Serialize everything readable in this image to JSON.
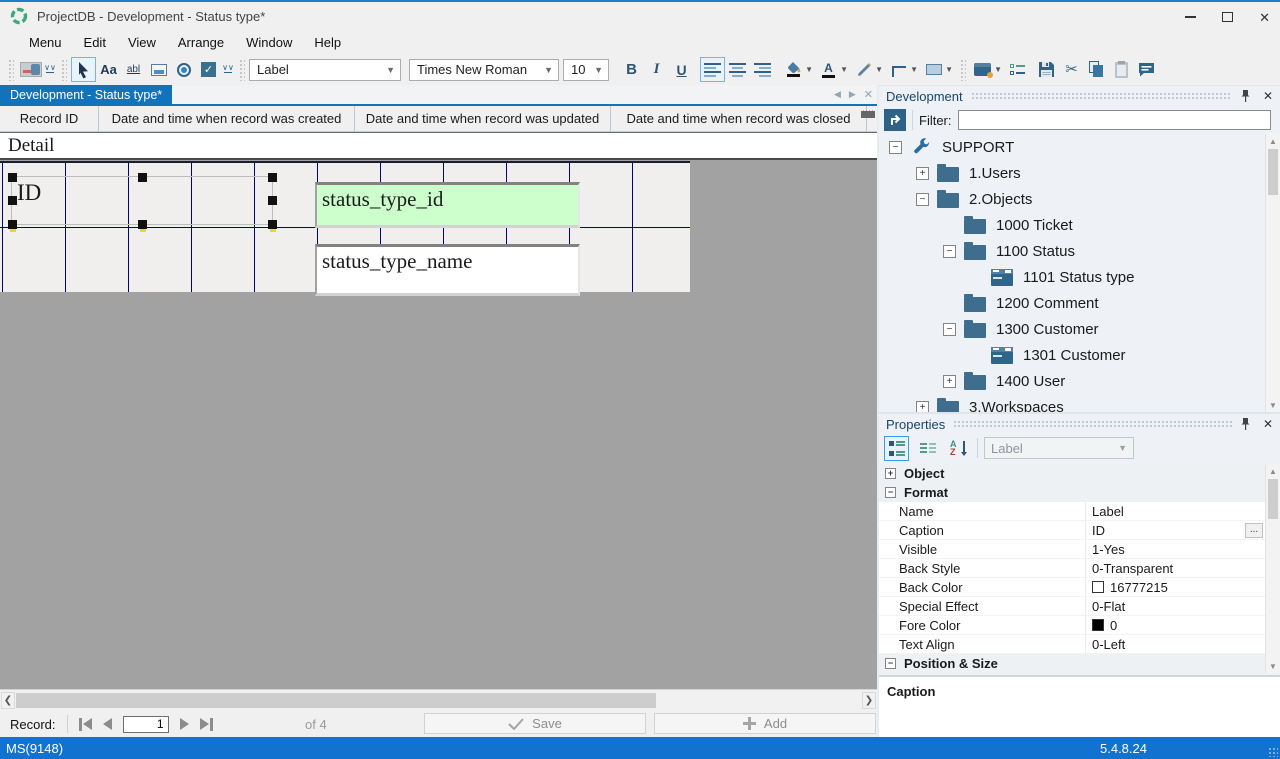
{
  "app": {
    "title": "ProjectDB - Development - Status type*",
    "status_left": "MS(9148)",
    "version": "5.4.8.24"
  },
  "menu": {
    "items": [
      "Menu",
      "Edit",
      "View",
      "Arrange",
      "Window",
      "Help"
    ]
  },
  "toolbar": {
    "control_selector": "Label",
    "font_name": "Times New Roman",
    "font_size": "10",
    "icons": {
      "bold": "B",
      "italic": "I",
      "underline": "U",
      "label_tool": "Aa",
      "textbox_tool": "abl",
      "checkbox_check": "✓",
      "cut": "✂"
    }
  },
  "tab_bar": {
    "active_tab": "Development - Status type*"
  },
  "grid_columns": {
    "headers": [
      "Record ID",
      "Date and time when record was created",
      "Date and time when record was updated",
      "Date and time when record was closed"
    ]
  },
  "designer": {
    "section_title": "Detail",
    "selected_label": "ID",
    "fields": [
      {
        "text": "status_type_id",
        "bg": "#ccffcc"
      },
      {
        "text": "status_type_name",
        "bg": "#ffffff"
      }
    ]
  },
  "development_panel": {
    "title": "Development",
    "filter_label": "Filter:",
    "filter_value": "",
    "tree": [
      {
        "depth": 0,
        "expander": "minus",
        "icon": "wrench",
        "label": "SUPPORT"
      },
      {
        "depth": 1,
        "expander": "plus",
        "icon": "folder",
        "label": "1.Users"
      },
      {
        "depth": 1,
        "expander": "minus",
        "icon": "folder",
        "label": "2.Objects"
      },
      {
        "depth": 2,
        "expander": "none",
        "icon": "folder",
        "label": "1000 Ticket"
      },
      {
        "depth": 2,
        "expander": "minus",
        "icon": "folder",
        "label": "1100 Status"
      },
      {
        "depth": 3,
        "expander": "none",
        "icon": "form",
        "label": "1101 Status type"
      },
      {
        "depth": 2,
        "expander": "none",
        "icon": "folder",
        "label": "1200 Comment"
      },
      {
        "depth": 2,
        "expander": "minus",
        "icon": "folder",
        "label": "1300 Customer"
      },
      {
        "depth": 3,
        "expander": "none",
        "icon": "form",
        "label": "1301 Customer"
      },
      {
        "depth": 2,
        "expander": "plus",
        "icon": "folder",
        "label": "1400 User"
      },
      {
        "depth": 1,
        "expander": "plus",
        "icon": "folder",
        "label": "3.Workspaces"
      }
    ]
  },
  "properties_panel": {
    "title": "Properties",
    "selector_value": "Label",
    "rows": [
      {
        "type": "section",
        "expander": "plus",
        "label": "Object"
      },
      {
        "type": "section",
        "expander": "minus",
        "label": "Format"
      },
      {
        "type": "prop",
        "name": "Name",
        "value": "Label"
      },
      {
        "type": "prop",
        "name": "Caption",
        "value": "ID",
        "ellipsis": "..."
      },
      {
        "type": "prop",
        "name": "Visible",
        "value": "1-Yes"
      },
      {
        "type": "prop",
        "name": "Back Style",
        "value": "0-Transparent"
      },
      {
        "type": "prop",
        "name": "Back Color",
        "value": "16777215",
        "swatch": "#ffffff"
      },
      {
        "type": "prop",
        "name": "Special Effect",
        "value": "0-Flat"
      },
      {
        "type": "prop",
        "name": "Fore Color",
        "value": "0",
        "swatch": "#000000"
      },
      {
        "type": "prop",
        "name": "Text Align",
        "value": "0-Left"
      },
      {
        "type": "section",
        "expander": "minus",
        "label": "Position & Size"
      }
    ],
    "description_title": "Caption"
  },
  "record_bar": {
    "label": "Record:",
    "current_record": "1",
    "count_text": "of 4",
    "save_label": "Save",
    "add_label": "Add"
  },
  "colors": {
    "accent_blue": "#1273bd",
    "status_bar_blue": "#1173cf",
    "grid_line_navy": "#000080",
    "field_green": "#ccffcc",
    "icon_steel_blue": "#2e6286"
  }
}
